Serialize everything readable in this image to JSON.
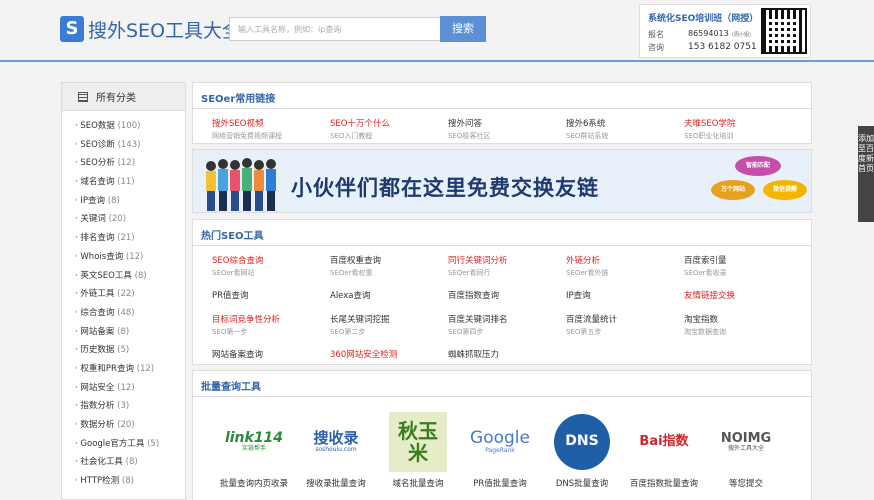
{
  "header": {
    "logo_letter": "S",
    "logo_text": "搜外SEO工具大全",
    "search_placeholder": "输入工具名称，例如：ip查询",
    "search_button": "搜索",
    "promo": {
      "title": "系统化SEO培训班（网授）",
      "line1_label": "报名",
      "line2_label": "咨询",
      "phone1": "86594013",
      "phone1_tag": "(周小姐)",
      "phone2": "153 6182 0751"
    }
  },
  "side_tab": "添加至百度新首页",
  "sidebar": {
    "title": "所有分类",
    "items": [
      {
        "label": "SEO数据",
        "count": "(100)"
      },
      {
        "label": "SEO诊断",
        "count": "(143)"
      },
      {
        "label": "SEO分析",
        "count": "(12)"
      },
      {
        "label": "域名查询",
        "count": "(11)"
      },
      {
        "label": "IP查询",
        "count": "(8)"
      },
      {
        "label": "关键词",
        "count": "(20)"
      },
      {
        "label": "排名查询",
        "count": "(21)"
      },
      {
        "label": "Whois查询",
        "count": "(12)"
      },
      {
        "label": "英文SEO工具",
        "count": "(8)"
      },
      {
        "label": "外链工具",
        "count": "(22)"
      },
      {
        "label": "综合查询",
        "count": "(48)"
      },
      {
        "label": "网站备案",
        "count": "(8)"
      },
      {
        "label": "历史数据",
        "count": "(5)"
      },
      {
        "label": "权重和PR查询",
        "count": "(12)"
      },
      {
        "label": "网站安全",
        "count": "(12)"
      },
      {
        "label": "指数分析",
        "count": "(3)"
      },
      {
        "label": "数据分析",
        "count": "(20)"
      },
      {
        "label": "Google官方工具",
        "count": "(5)"
      },
      {
        "label": "社会化工具",
        "count": "(8)"
      },
      {
        "label": "HTTP检测",
        "count": "(8)"
      }
    ]
  },
  "common_links": {
    "title": "SEOer常用链接",
    "items": [
      {
        "title": "搜外SEO视频",
        "sub": "网络营销免费视频课程",
        "red": true
      },
      {
        "title": "SEO十万个什么",
        "sub": "SEO入门教程",
        "red": true
      },
      {
        "title": "搜外问答",
        "sub": "SEO极客社区",
        "red": false
      },
      {
        "title": "搜外6系统",
        "sub": "SEO群站系统",
        "red": false
      },
      {
        "title": "夫唯SEO学院",
        "sub": "SEO职业化培训",
        "red": true
      }
    ]
  },
  "banner": {
    "text": "小伙伴们都在这里免费交换友链",
    "bubble1": "智能匹配",
    "bubble2": "万个网站",
    "bubble3": "微信提醒"
  },
  "hot_tools": {
    "title": "热门SEO工具",
    "items": [
      {
        "title": "SEO综合查询",
        "sub": "SEOer看网站",
        "red": true
      },
      {
        "title": "百度权重查询",
        "sub": "SEOer看权重",
        "red": false
      },
      {
        "title": "同行关键词分析",
        "sub": "SEOer看同行",
        "red": true
      },
      {
        "title": "外链分析",
        "sub": "SEOer看外链",
        "red": true
      },
      {
        "title": "百度索引量",
        "sub": "SEOer看收录",
        "red": false
      },
      {
        "title": "PR值查询",
        "sub": "",
        "red": false
      },
      {
        "title": "Alexa查询",
        "sub": "",
        "red": false
      },
      {
        "title": "百度指数查询",
        "sub": "",
        "red": false
      },
      {
        "title": "IP查询",
        "sub": "",
        "red": false
      },
      {
        "title": "友情链接交换",
        "sub": "",
        "red": true
      },
      {
        "title": "目标词竞争性分析",
        "sub": "SEO第一步",
        "red": true
      },
      {
        "title": "长尾关键词挖掘",
        "sub": "SEO第二步",
        "red": false
      },
      {
        "title": "百度关键词排名",
        "sub": "SEO第四步",
        "red": false
      },
      {
        "title": "百度流量统计",
        "sub": "SEO第五步",
        "red": false
      },
      {
        "title": "淘宝指数",
        "sub": "淘宝数据查询",
        "red": false
      },
      {
        "title": "网站备案查询",
        "sub": "",
        "red": false
      },
      {
        "title": "360网站安全检测",
        "sub": "",
        "red": true
      },
      {
        "title": "蜘蛛抓取压力",
        "sub": "",
        "red": false
      }
    ]
  },
  "batch_tools": {
    "title": "批量查询工具",
    "items": [
      {
        "label": "批量查询内页收录",
        "logo": "link114",
        "logo_sub": "实链帮手"
      },
      {
        "label": "搜收录批量查询",
        "logo": "搜收录",
        "logo_sub": "soshoulu.com"
      },
      {
        "label": "域名批量查询",
        "logo": "秋玉米",
        "logo_sub": ""
      },
      {
        "label": "PR值批量查询",
        "logo": "Google",
        "logo_sub": "PageRank"
      },
      {
        "label": "DNS批量查询",
        "logo": "DNS",
        "logo_sub": ""
      },
      {
        "label": "百度指数批量查询",
        "logo": "Bai指数",
        "logo_sub": ""
      },
      {
        "label": "等您提交",
        "logo": "NOIMG",
        "logo_sub": "搜外工具大全"
      }
    ]
  }
}
